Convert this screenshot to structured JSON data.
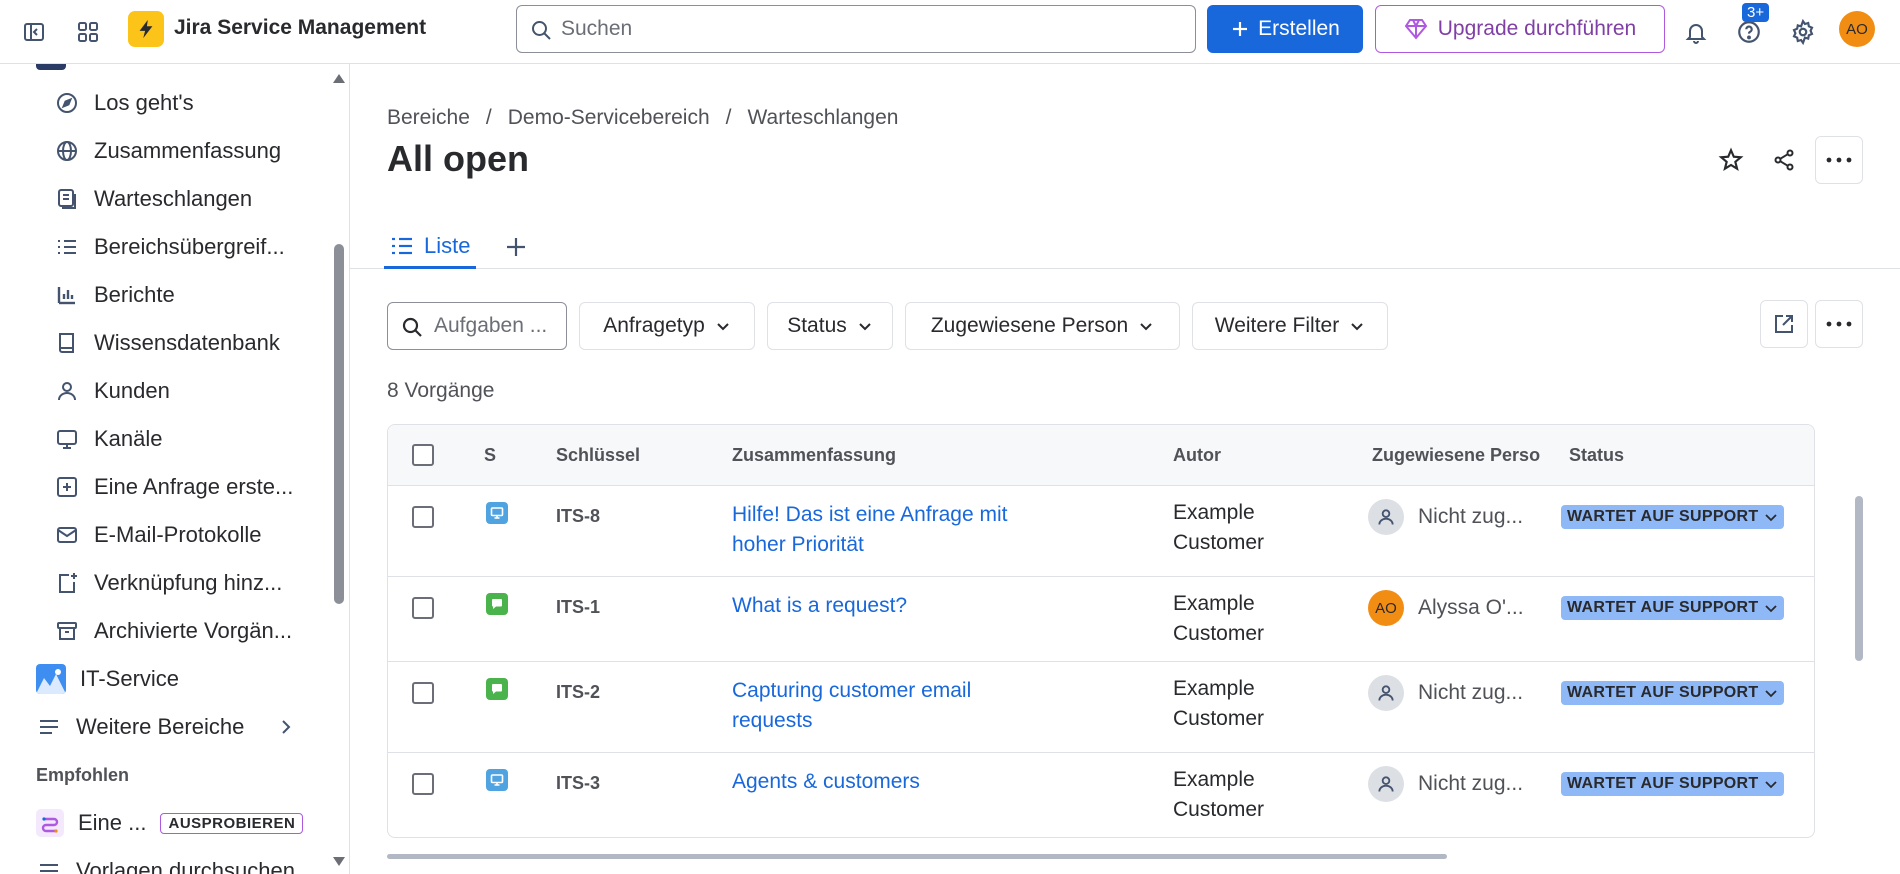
{
  "topbar": {
    "app_title": "Jira Service Management",
    "search_placeholder": "Suchen",
    "create_label": "Erstellen",
    "upgrade_label": "Upgrade durchführen",
    "help_badge": "3+",
    "avatar_initials": "AO"
  },
  "sidebar": {
    "items": [
      {
        "label": "Los geht's",
        "icon": "compass-icon"
      },
      {
        "label": "Zusammenfassung",
        "icon": "globe-icon"
      },
      {
        "label": "Warteschlangen",
        "icon": "queue-icon"
      },
      {
        "label": "Bereichsübergreif...",
        "icon": "list-icon"
      },
      {
        "label": "Berichte",
        "icon": "chart-icon"
      },
      {
        "label": "Wissensdatenbank",
        "icon": "book-icon"
      },
      {
        "label": "Kunden",
        "icon": "person-icon"
      },
      {
        "label": "Kanäle",
        "icon": "monitor-icon"
      },
      {
        "label": "Eine Anfrage erste...",
        "icon": "plus-square-icon"
      },
      {
        "label": "E-Mail-Protokolle",
        "icon": "mail-icon"
      },
      {
        "label": "Verknüpfung hinz...",
        "icon": "link-add-icon"
      },
      {
        "label": "Archivierte Vorgän...",
        "icon": "archive-icon"
      }
    ],
    "project": "IT-Service",
    "more_spaces": "Weitere Bereiche",
    "recommended_label": "Empfohlen",
    "recommended_item": "Eine ...",
    "try_badge": "AUSPROBIEREN",
    "templates": "Vorlagen durchsuchen"
  },
  "main": {
    "breadcrumb": [
      "Bereiche",
      "Demo-Servicebereich",
      "Warteschlangen"
    ],
    "breadcrumb_sep": "/",
    "title": "All open",
    "tab_list": "Liste",
    "filter_search_placeholder": "Aufgaben ...",
    "filters": [
      "Anfragetyp",
      "Status",
      "Zugewiesene Person",
      "Weitere Filter"
    ],
    "count": "8 Vorgänge"
  },
  "table": {
    "headers": [
      "S",
      "Schlüssel",
      "Zusammenfassung",
      "Autor",
      "Zugewiesene Perso",
      "Status"
    ],
    "rows": [
      {
        "type": "monitor",
        "key": "ITS-8",
        "summary": "Hilfe! Das ist eine Anfrage mit hoher Priorität",
        "author": "Example Customer",
        "assignee": "Nicht zug...",
        "assignee_avatar": "",
        "status": "WARTET AUF SUPPORT"
      },
      {
        "type": "chat",
        "key": "ITS-1",
        "summary": "What is a request?",
        "author": "Example Customer",
        "assignee": "Alyssa O'...",
        "assignee_avatar": "AO",
        "status": "WARTET AUF SUPPORT"
      },
      {
        "type": "chat",
        "key": "ITS-2",
        "summary": "Capturing customer email requests",
        "author": "Example Customer",
        "assignee": "Nicht zug...",
        "assignee_avatar": "",
        "status": "WARTET AUF SUPPORT"
      },
      {
        "type": "monitor",
        "key": "ITS-3",
        "summary": "Agents & customers",
        "author": "Example Customer",
        "assignee": "Nicht zug...",
        "assignee_avatar": "",
        "status": "WARTET AUF SUPPORT"
      }
    ]
  },
  "colors": {
    "primary": "#1868db",
    "upgrade": "#af59e1",
    "status_bg": "#8fb8f6",
    "logo": "#fcc419",
    "avatar": "#f18d13"
  }
}
